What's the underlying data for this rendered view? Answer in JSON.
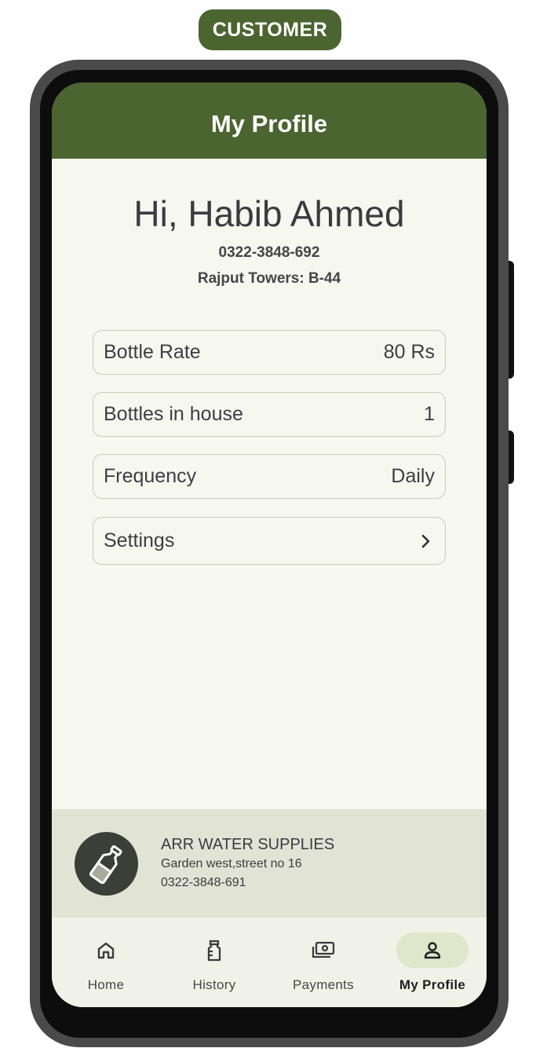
{
  "badge": "CUSTOMER",
  "app_bar": {
    "title": "My Profile"
  },
  "profile": {
    "greeting": "Hi, Habib Ahmed",
    "phone": "0322-3848-692",
    "address": "Rajput Towers: B-44"
  },
  "info_rows": [
    {
      "label": "Bottle Rate",
      "value": "80 Rs"
    },
    {
      "label": "Bottles in house",
      "value": "1"
    },
    {
      "label": "Frequency",
      "value": "Daily"
    },
    {
      "label": "Settings",
      "icon": "chevron-right-icon"
    }
  ],
  "supplier": {
    "name": "ARR WATER SUPPLIES",
    "address": "Garden west,street no 16",
    "phone": "0322-3848-691",
    "logo_icon": "water-bottle-icon"
  },
  "nav": [
    {
      "label": "Home",
      "icon": "home-icon"
    },
    {
      "label": "History",
      "icon": "history-icon"
    },
    {
      "label": "Payments",
      "icon": "payments-icon"
    },
    {
      "label": "My Profile",
      "icon": "person-icon",
      "active": true
    }
  ],
  "colors": {
    "brand_green": "#4b6430",
    "screen_bg": "#f6f7ee",
    "supplier_bg": "#e1e3d5",
    "active_pill": "#dfe6c9",
    "text": "#3d3e42"
  }
}
